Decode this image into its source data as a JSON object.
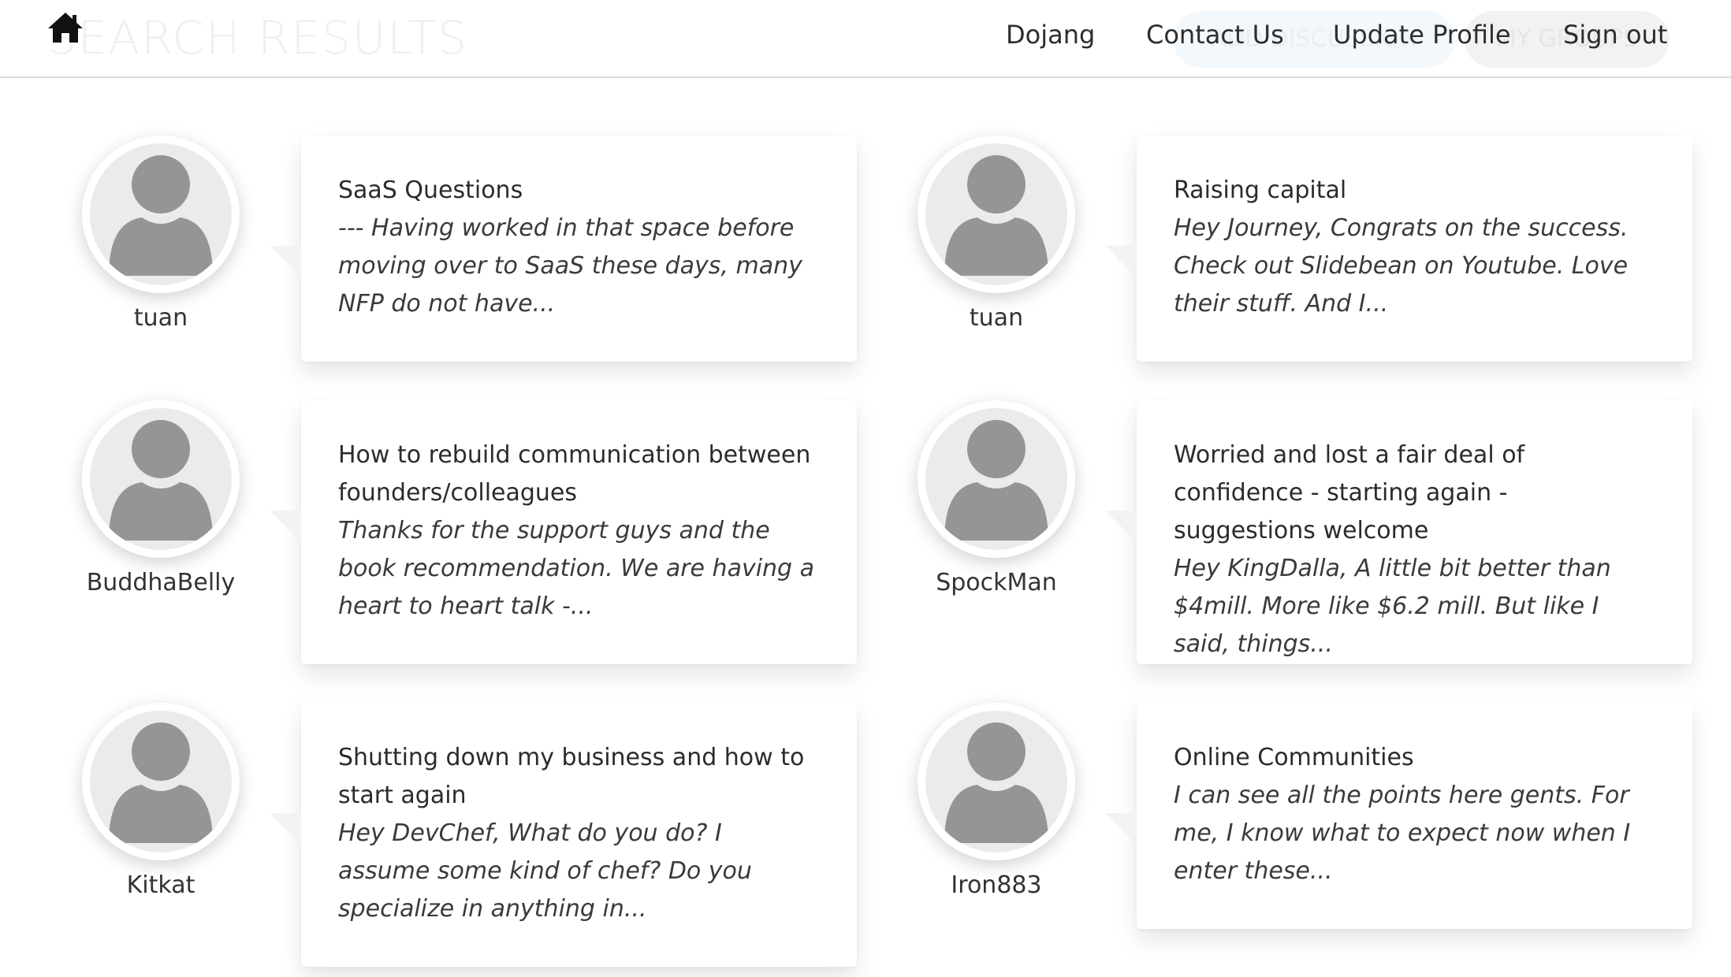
{
  "header": {
    "ghost_title": "SEARCH RESULTS",
    "ghost_pill_a": "ADD DISCUSSION",
    "ghost_pill_b": "MY GROUPS",
    "nav": [
      "Dojang",
      "Contact Us",
      "Update Profile",
      "Sign out"
    ]
  },
  "icons": {
    "home": "home-icon",
    "avatar": "user-silhouette-icon"
  },
  "results": [
    {
      "user": "tuan",
      "title": "SaaS Questions",
      "excerpt": "--- Having worked in that space before moving over to SaaS these days, many NFP do not have..."
    },
    {
      "user": "tuan",
      "title": "Raising capital",
      "excerpt": "Hey Journey,  Congrats on the success. Check out Slidebean on Youtube. Love their stuff. And I..."
    },
    {
      "user": "BuddhaBelly",
      "title": "How to rebuild communication between founders/colleagues",
      "excerpt": "Thanks for the support guys and the book recommendation. We are having a heart to heart talk -..."
    },
    {
      "user": "SpockMan",
      "title": "Worried and lost a fair deal of confidence - starting again - suggestions welcome",
      "excerpt": "Hey KingDalla, A little bit better than $4mill. More like $6.2 mill.  But like I said, things..."
    },
    {
      "user": "Kitkat",
      "title": "Shutting down my business and how to start again",
      "excerpt": "Hey DevChef,  What do you do? I assume some kind of chef? Do you specialize in anything in..."
    },
    {
      "user": "Iron883",
      "title": "Online Communities",
      "excerpt": "I can see all the points here gents.  For me, I know what to expect now when I enter these..."
    }
  ]
}
